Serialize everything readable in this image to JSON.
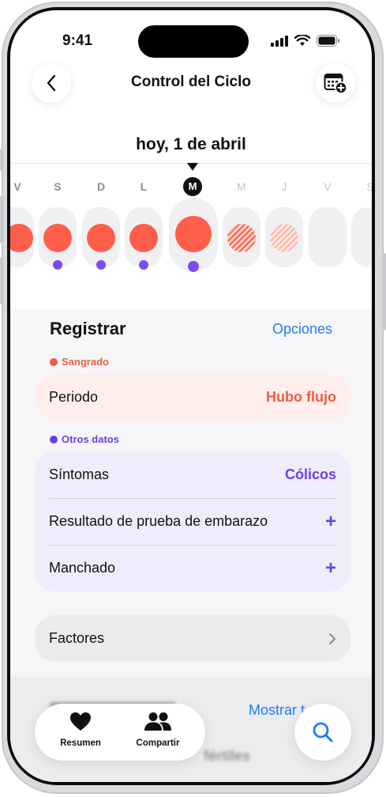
{
  "status": {
    "time": "9:41"
  },
  "nav": {
    "title": "Control del Ciclo"
  },
  "date_title": "hoy, 1 de abril",
  "days": [
    {
      "letter": "V"
    },
    {
      "letter": "S"
    },
    {
      "letter": "D"
    },
    {
      "letter": "L"
    },
    {
      "letter": "M"
    },
    {
      "letter": "M"
    },
    {
      "letter": "J"
    },
    {
      "letter": "V"
    },
    {
      "letter": "S"
    }
  ],
  "log": {
    "title": "Registrar",
    "options": "Opciones",
    "bleeding_tag": "Sangrado",
    "period_label": "Periodo",
    "period_value": "Hubo flujo",
    "other_tag": "Otros datos",
    "symptoms_label": "Síntomas",
    "symptoms_value": "Cólicos",
    "pregnancy_label": "Resultado de prueba de embarazo",
    "spotting_label": "Manchado",
    "plus": "+",
    "factors_label": "Factores"
  },
  "behind": {
    "show_all": "Mostrar t",
    "fertile": "fértiles"
  },
  "tabbar": {
    "summary": "Resumen",
    "share": "Compartir"
  },
  "colors": {
    "accent": "#1d7cf2",
    "period": "#ff5f4a",
    "purple": "#6a40e8"
  }
}
